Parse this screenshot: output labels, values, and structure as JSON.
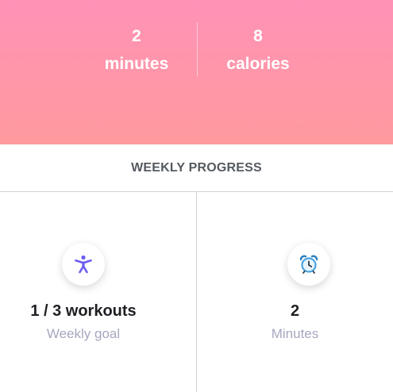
{
  "summary": {
    "minutes_value": "2",
    "minutes_unit": "minutes",
    "calories_value": "8",
    "calories_unit": "calories"
  },
  "weekly_progress": {
    "title": "WEEKLY PROGRESS",
    "workouts": {
      "value": "1 / 3 workouts",
      "label": "Weekly goal",
      "icon": "person-exercise-icon",
      "icon_color": "#6b5cf0"
    },
    "minutes": {
      "value": "2",
      "label": "Minutes",
      "icon": "alarm-clock-icon",
      "icon_color": "#4aa3df"
    }
  },
  "colors": {
    "hero_top": "#ff92b6",
    "hero_bottom": "#ff9a9e",
    "label_gray": "#a6a7bf"
  }
}
